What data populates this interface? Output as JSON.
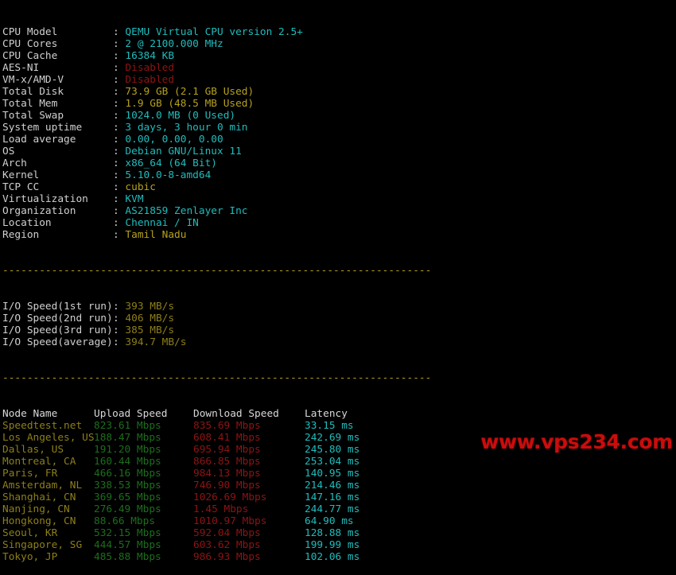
{
  "terminal": {
    "sysinfo": [
      {
        "label": "CPU Model",
        "value": "QEMU Virtual CPU version 2.5+",
        "color": "v-cyan"
      },
      {
        "label": "CPU Cores",
        "value": "2 @ 2100.000 MHz",
        "color": "v-cyan"
      },
      {
        "label": "CPU Cache",
        "value": "16384 KB",
        "color": "v-cyan"
      },
      {
        "label": "AES-NI",
        "value": "Disabled",
        "color": "v-red"
      },
      {
        "label": "VM-x/AMD-V",
        "value": "Disabled",
        "color": "v-red"
      },
      {
        "label": "Total Disk",
        "value": "73.9 GB (2.1 GB Used)",
        "color": "v-yellow"
      },
      {
        "label": "Total Mem",
        "value": "1.9 GB (48.5 MB Used)",
        "color": "v-yellow"
      },
      {
        "label": "Total Swap",
        "value": "1024.0 MB (0 Used)",
        "color": "v-cyan"
      },
      {
        "label": "System uptime",
        "value": "3 days, 3 hour 0 min",
        "color": "v-cyan"
      },
      {
        "label": "Load average",
        "value": "0.00, 0.00, 0.00",
        "color": "v-cyan"
      },
      {
        "label": "OS",
        "value": "Debian GNU/Linux 11",
        "color": "v-cyan"
      },
      {
        "label": "Arch",
        "value": "x86_64 (64 Bit)",
        "color": "v-cyan"
      },
      {
        "label": "Kernel",
        "value": "5.10.0-8-amd64",
        "color": "v-cyan"
      },
      {
        "label": "TCP CC",
        "value": "cubic",
        "color": "v-yellow"
      },
      {
        "label": "Virtualization",
        "value": "KVM",
        "color": "v-cyan"
      },
      {
        "label": "Organization",
        "value": "AS21859 Zenlayer Inc",
        "color": "v-cyan"
      },
      {
        "label": "Location",
        "value": "Chennai / IN",
        "color": "v-cyan"
      },
      {
        "label": "Region",
        "value": "Tamil Nadu",
        "color": "v-yellow"
      }
    ],
    "separator": "----------------------------------------------------------------------",
    "io_speed": [
      {
        "label": "I/O Speed(1st run)",
        "value": "393 MB/s"
      },
      {
        "label": "I/O Speed(2nd run)",
        "value": "406 MB/s"
      },
      {
        "label": "I/O Speed(3rd run)",
        "value": "385 MB/s"
      },
      {
        "label": "I/O Speed(average)",
        "value": "394.7 MB/s"
      }
    ],
    "speedtest": {
      "headers": {
        "node": "Node Name",
        "upload": "Upload Speed",
        "download": "Download Speed",
        "latency": "Latency"
      },
      "rows": [
        {
          "node": "Speedtest.net",
          "upload": "823.61 Mbps",
          "download": "835.69 Mbps",
          "latency": "33.15 ms"
        },
        {
          "node": "Los Angeles, US",
          "upload": "188.47 Mbps",
          "download": "608.41 Mbps",
          "latency": "242.69 ms"
        },
        {
          "node": "Dallas, US",
          "upload": "191.20 Mbps",
          "download": "695.94 Mbps",
          "latency": "245.80 ms"
        },
        {
          "node": "Montreal, CA",
          "upload": "160.44 Mbps",
          "download": "866.85 Mbps",
          "latency": "253.04 ms"
        },
        {
          "node": "Paris, FR",
          "upload": "466.16 Mbps",
          "download": "984.13 Mbps",
          "latency": "140.95 ms"
        },
        {
          "node": "Amsterdam, NL",
          "upload": "338.53 Mbps",
          "download": "746.90 Mbps",
          "latency": "214.46 ms"
        },
        {
          "node": "Shanghai, CN",
          "upload": "369.65 Mbps",
          "download": "1026.69 Mbps",
          "latency": "147.16 ms"
        },
        {
          "node": "Nanjing, CN",
          "upload": "276.49 Mbps",
          "download": "1.45 Mbps",
          "latency": "244.77 ms"
        },
        {
          "node": "Hongkong, CN",
          "upload": "88.66 Mbps",
          "download": "1010.97 Mbps",
          "latency": "64.90 ms"
        },
        {
          "node": "Seoul, KR",
          "upload": "532.15 Mbps",
          "download": "592.04 Mbps",
          "latency": "128.88 ms"
        },
        {
          "node": "Singapore, SG",
          "upload": "444.57 Mbps",
          "download": "603.62 Mbps",
          "latency": "199.99 ms"
        },
        {
          "node": "Tokyo, JP",
          "upload": "485.88 Mbps",
          "download": "986.93 Mbps",
          "latency": "102.06 ms"
        }
      ]
    },
    "watermark": "www.vps234.com"
  }
}
